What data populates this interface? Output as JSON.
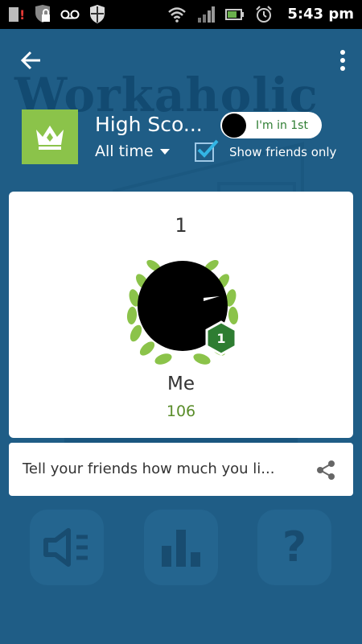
{
  "status_bar": {
    "time": "5:43 pm",
    "icons": [
      "sd-card-alert-icon",
      "lock-icon",
      "voicemail-icon",
      "shield-icon",
      "wifi-icon",
      "signal-icon",
      "battery-icon",
      "alarm-icon"
    ]
  },
  "background": {
    "app_title": "Workaholic"
  },
  "header": {
    "back_icon": "back-arrow-icon",
    "menu_icon": "overflow-menu-icon",
    "leaderboard_icon": "crown-icon",
    "title": "High Sco...",
    "time_filter": "All time",
    "rank_chip_label": "I'm in 1st",
    "show_friends_label": "Show friends only",
    "show_friends_checked": true
  },
  "leaderboard_entry": {
    "rank": "1",
    "player_name": "Me",
    "score": "106",
    "badge_number": "1"
  },
  "share": {
    "text": "Tell your friends how much you li...",
    "icon": "share-icon"
  },
  "bottom_buttons": [
    {
      "name": "sound-icon"
    },
    {
      "name": "stats-icon"
    },
    {
      "name": "help-icon",
      "label": "?"
    }
  ],
  "colors": {
    "background": "#1f5d86",
    "accent_green": "#8bc34a",
    "badge_green": "#2e7d32",
    "check_blue": "#33b5e5"
  }
}
